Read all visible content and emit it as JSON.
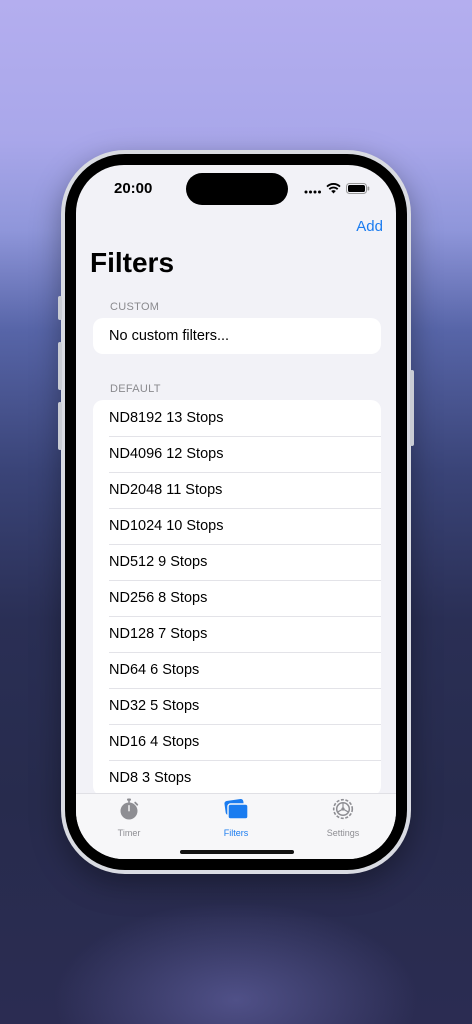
{
  "status_bar": {
    "time": "20:00"
  },
  "nav": {
    "add_label": "Add",
    "title": "Filters"
  },
  "sections": {
    "custom": {
      "header": "CUSTOM",
      "rows": [
        "No custom filters..."
      ]
    },
    "default": {
      "header": "DEFAULT",
      "rows": [
        "ND8192 13 Stops",
        "ND4096 12 Stops",
        "ND2048 11 Stops",
        "ND1024 10 Stops",
        "ND512 9 Stops",
        "ND256 8 Stops",
        "ND128 7 Stops",
        "ND64 6 Stops",
        "ND32 5 Stops",
        "ND16 4 Stops",
        "ND8 3 Stops"
      ]
    }
  },
  "tabbar": {
    "tabs": [
      {
        "label": "Timer",
        "icon": "stopwatch-icon",
        "selected": false
      },
      {
        "label": "Filters",
        "icon": "filters-icon",
        "selected": true
      },
      {
        "label": "Settings",
        "icon": "gear-icon",
        "selected": false
      }
    ]
  },
  "colors": {
    "accent": "#1a7cf0",
    "inactive_tab": "#8e8e93",
    "background": "#f2f2f7"
  }
}
